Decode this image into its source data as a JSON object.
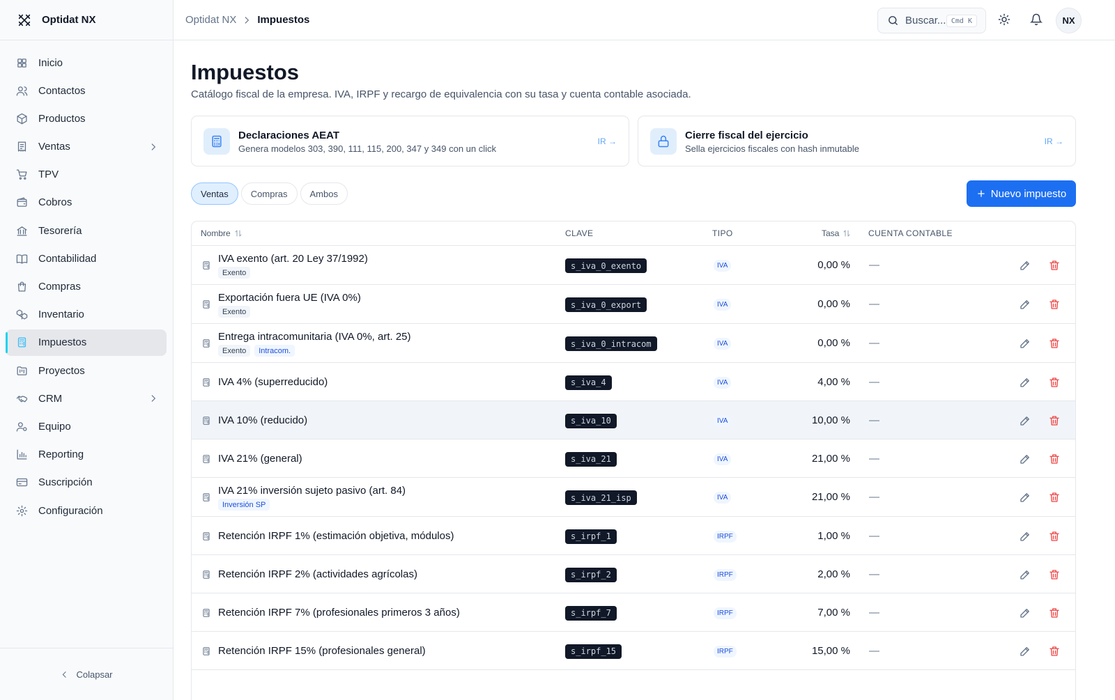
{
  "brand": {
    "name": "Optidat NX"
  },
  "sidebar": {
    "items": [
      {
        "label": "Inicio",
        "icon": "grid-icon"
      },
      {
        "label": "Contactos",
        "icon": "users-icon"
      },
      {
        "label": "Productos",
        "icon": "package-icon"
      },
      {
        "label": "Ventas",
        "icon": "receipt-icon",
        "expandable": true
      },
      {
        "label": "TPV",
        "icon": "cart-icon"
      },
      {
        "label": "Cobros",
        "icon": "wallet-icon"
      },
      {
        "label": "Tesorería",
        "icon": "bank-icon"
      },
      {
        "label": "Contabilidad",
        "icon": "book-icon"
      },
      {
        "label": "Compras",
        "icon": "shopping-bag-icon"
      },
      {
        "label": "Inventario",
        "icon": "boxes-icon"
      },
      {
        "label": "Impuestos",
        "icon": "calculator-icon",
        "active": true
      },
      {
        "label": "Proyectos",
        "icon": "folder-kanban-icon"
      },
      {
        "label": "CRM",
        "icon": "handshake-icon",
        "expandable": true
      },
      {
        "label": "Equipo",
        "icon": "user-cog-icon"
      },
      {
        "label": "Reporting",
        "icon": "bar-chart-icon"
      },
      {
        "label": "Suscripción",
        "icon": "credit-card-icon"
      },
      {
        "label": "Configuración",
        "icon": "gear-icon"
      }
    ],
    "collapse_label": "Colapsar"
  },
  "topbar": {
    "breadcrumb": [
      "Optidat NX",
      "Impuestos"
    ],
    "search_placeholder": "Buscar...",
    "search_shortcut": "Cmd K",
    "avatar_initials": "NX"
  },
  "page": {
    "title": "Impuestos",
    "subtitle": "Catálogo fiscal de la empresa. IVA, IRPF y recargo de equivalencia con su tasa y cuenta contable asociada."
  },
  "cards": [
    {
      "title": "Declaraciones AEAT",
      "desc": "Genera modelos 303, 390, 111, 115, 200, 347 y 349 con un click",
      "link": "IR →",
      "icon": "calculator-icon"
    },
    {
      "title": "Cierre fiscal del ejercicio",
      "desc": "Sella ejercicios fiscales con hash inmutable",
      "link": "IR →",
      "icon": "lock-icon"
    }
  ],
  "filters": {
    "tabs": [
      "Ventas",
      "Compras",
      "Ambos"
    ],
    "active": "Ventas"
  },
  "new_button_label": "Nuevo impuesto",
  "colors": {
    "accent": "#1d6ff2",
    "active_bar": "#22d3ee",
    "danger": "#ef4444",
    "code_bg": "#111827"
  },
  "table": {
    "columns": {
      "name": "Nombre",
      "key": "CLAVE",
      "type": "TIPO",
      "rate": "Tasa",
      "account": "CUENTA CONTABLE"
    },
    "rows": [
      {
        "name": "IVA exento (art. 20 Ley 37/1992)",
        "tags": [
          {
            "text": "Exento",
            "style": "gray"
          }
        ],
        "key": "s_iva_0_exento",
        "type": "IVA",
        "rate": "0,00 %",
        "account": "—"
      },
      {
        "name": "Exportación fuera UE (IVA 0%)",
        "tags": [
          {
            "text": "Exento",
            "style": "gray"
          }
        ],
        "key": "s_iva_0_export",
        "type": "IVA",
        "rate": "0,00 %",
        "account": "—"
      },
      {
        "name": "Entrega intracomunitaria (IVA 0%, art. 25)",
        "tags": [
          {
            "text": "Exento",
            "style": "gray"
          },
          {
            "text": "Intracom.",
            "style": "blue"
          }
        ],
        "key": "s_iva_0_intracom",
        "type": "IVA",
        "rate": "0,00 %",
        "account": "—"
      },
      {
        "name": "IVA 4% (superreducido)",
        "tags": [],
        "key": "s_iva_4",
        "type": "IVA",
        "rate": "4,00 %",
        "account": "—"
      },
      {
        "name": "IVA 10% (reducido)",
        "tags": [],
        "key": "s_iva_10",
        "type": "IVA",
        "rate": "10,00 %",
        "account": "—",
        "highlighted": true
      },
      {
        "name": "IVA 21% (general)",
        "tags": [],
        "key": "s_iva_21",
        "type": "IVA",
        "rate": "21,00 %",
        "account": "—"
      },
      {
        "name": "IVA 21% inversión sujeto pasivo (art. 84)",
        "tags": [
          {
            "text": "Inversión SP",
            "style": "blue"
          }
        ],
        "key": "s_iva_21_isp",
        "type": "IVA",
        "rate": "21,00 %",
        "account": "—"
      },
      {
        "name": "Retención IRPF 1% (estimación objetiva, módulos)",
        "tags": [],
        "key": "s_irpf_1",
        "type": "IRPF",
        "rate": "1,00 %",
        "account": "—"
      },
      {
        "name": "Retención IRPF 2% (actividades agrícolas)",
        "tags": [],
        "key": "s_irpf_2",
        "type": "IRPF",
        "rate": "2,00 %",
        "account": "—"
      },
      {
        "name": "Retención IRPF 7% (profesionales primeros 3 años)",
        "tags": [],
        "key": "s_irpf_7",
        "type": "IRPF",
        "rate": "7,00 %",
        "account": "—"
      },
      {
        "name": "Retención IRPF 15% (profesionales general)",
        "tags": [],
        "key": "s_irpf_15",
        "type": "IRPF",
        "rate": "15,00 %",
        "account": "—"
      }
    ]
  }
}
